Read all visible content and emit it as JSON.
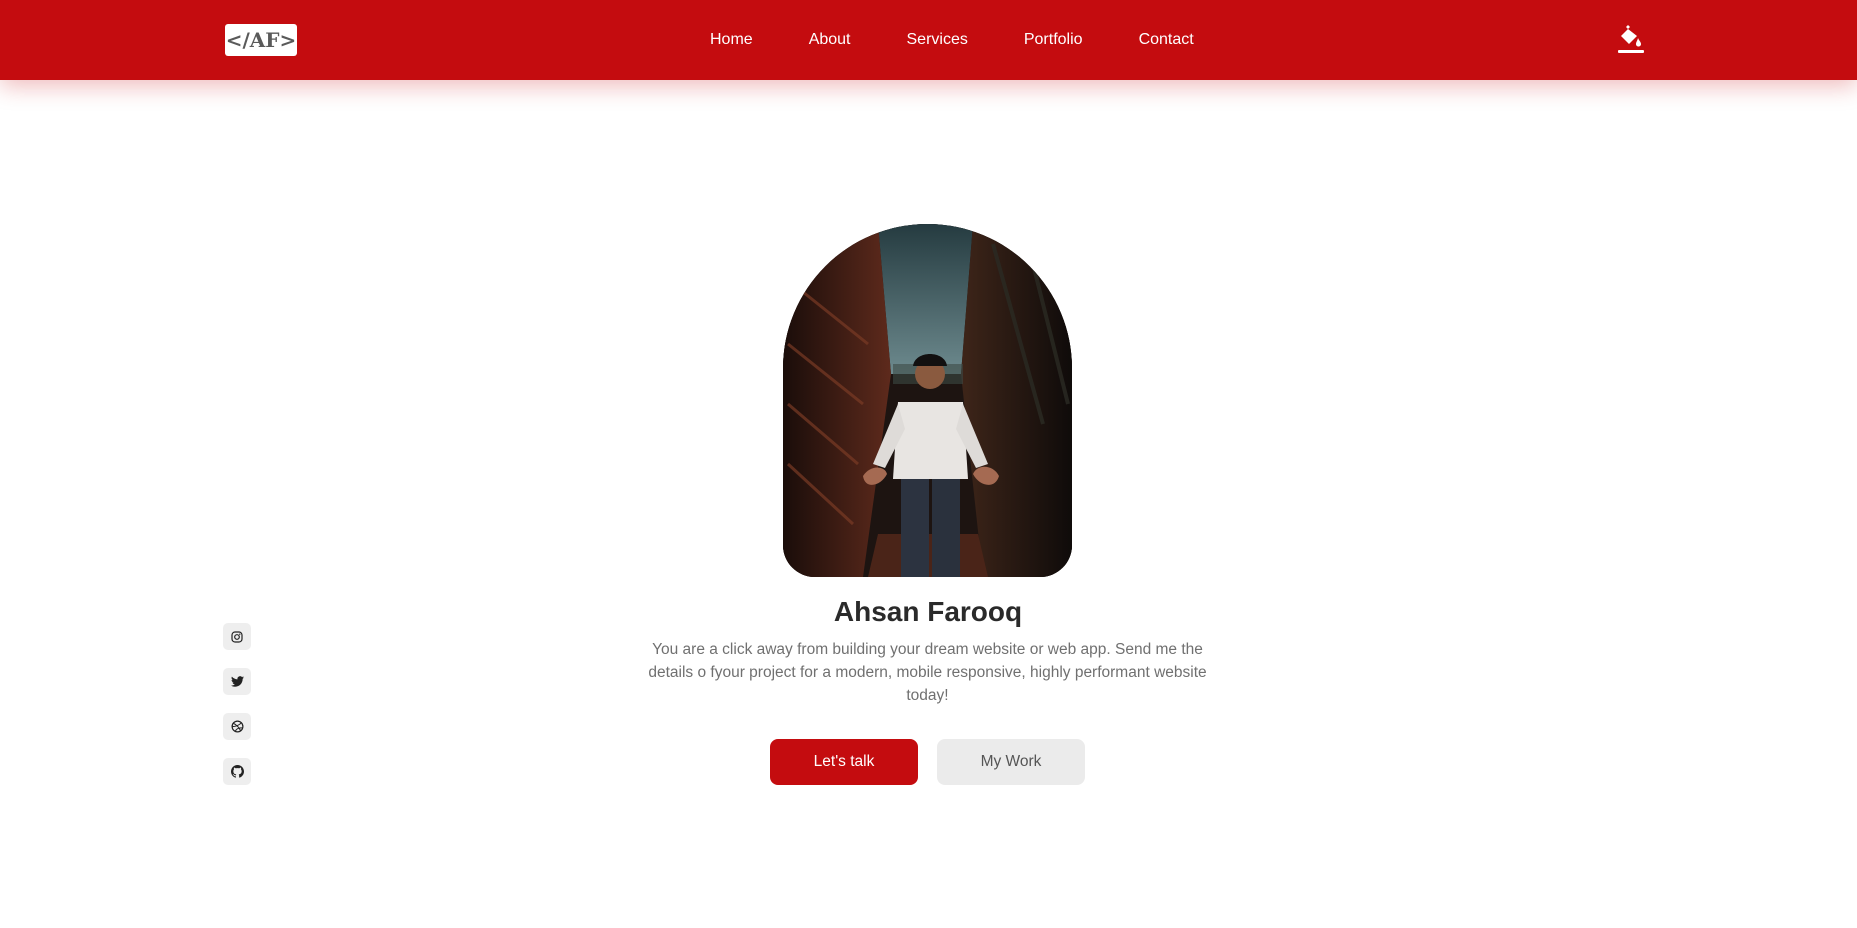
{
  "header": {
    "logo_text": "</AF>",
    "nav": [
      {
        "label": "Home"
      },
      {
        "label": "About"
      },
      {
        "label": "Services"
      },
      {
        "label": "Portfolio"
      },
      {
        "label": "Contact"
      }
    ],
    "theme_icon": "paint-bucket-icon"
  },
  "hero": {
    "photo_alt": "Ahsan Farooq",
    "name": "Ahsan Farooq",
    "description": "You are a click away from building your dream website or web app. Send me the details o fyour project for a modern, mobile responsive, highly performant website today!",
    "primary_button": "Let's talk",
    "secondary_button": "My Work"
  },
  "social": [
    {
      "icon": "instagram-icon"
    },
    {
      "icon": "twitter-icon"
    },
    {
      "icon": "dribbble-icon"
    },
    {
      "icon": "github-icon"
    }
  ],
  "colors": {
    "brand_red": "#c40c0f",
    "secondary_button_bg": "#ebebeb",
    "text_dark": "#2a2a2a",
    "text_muted": "#707070"
  }
}
